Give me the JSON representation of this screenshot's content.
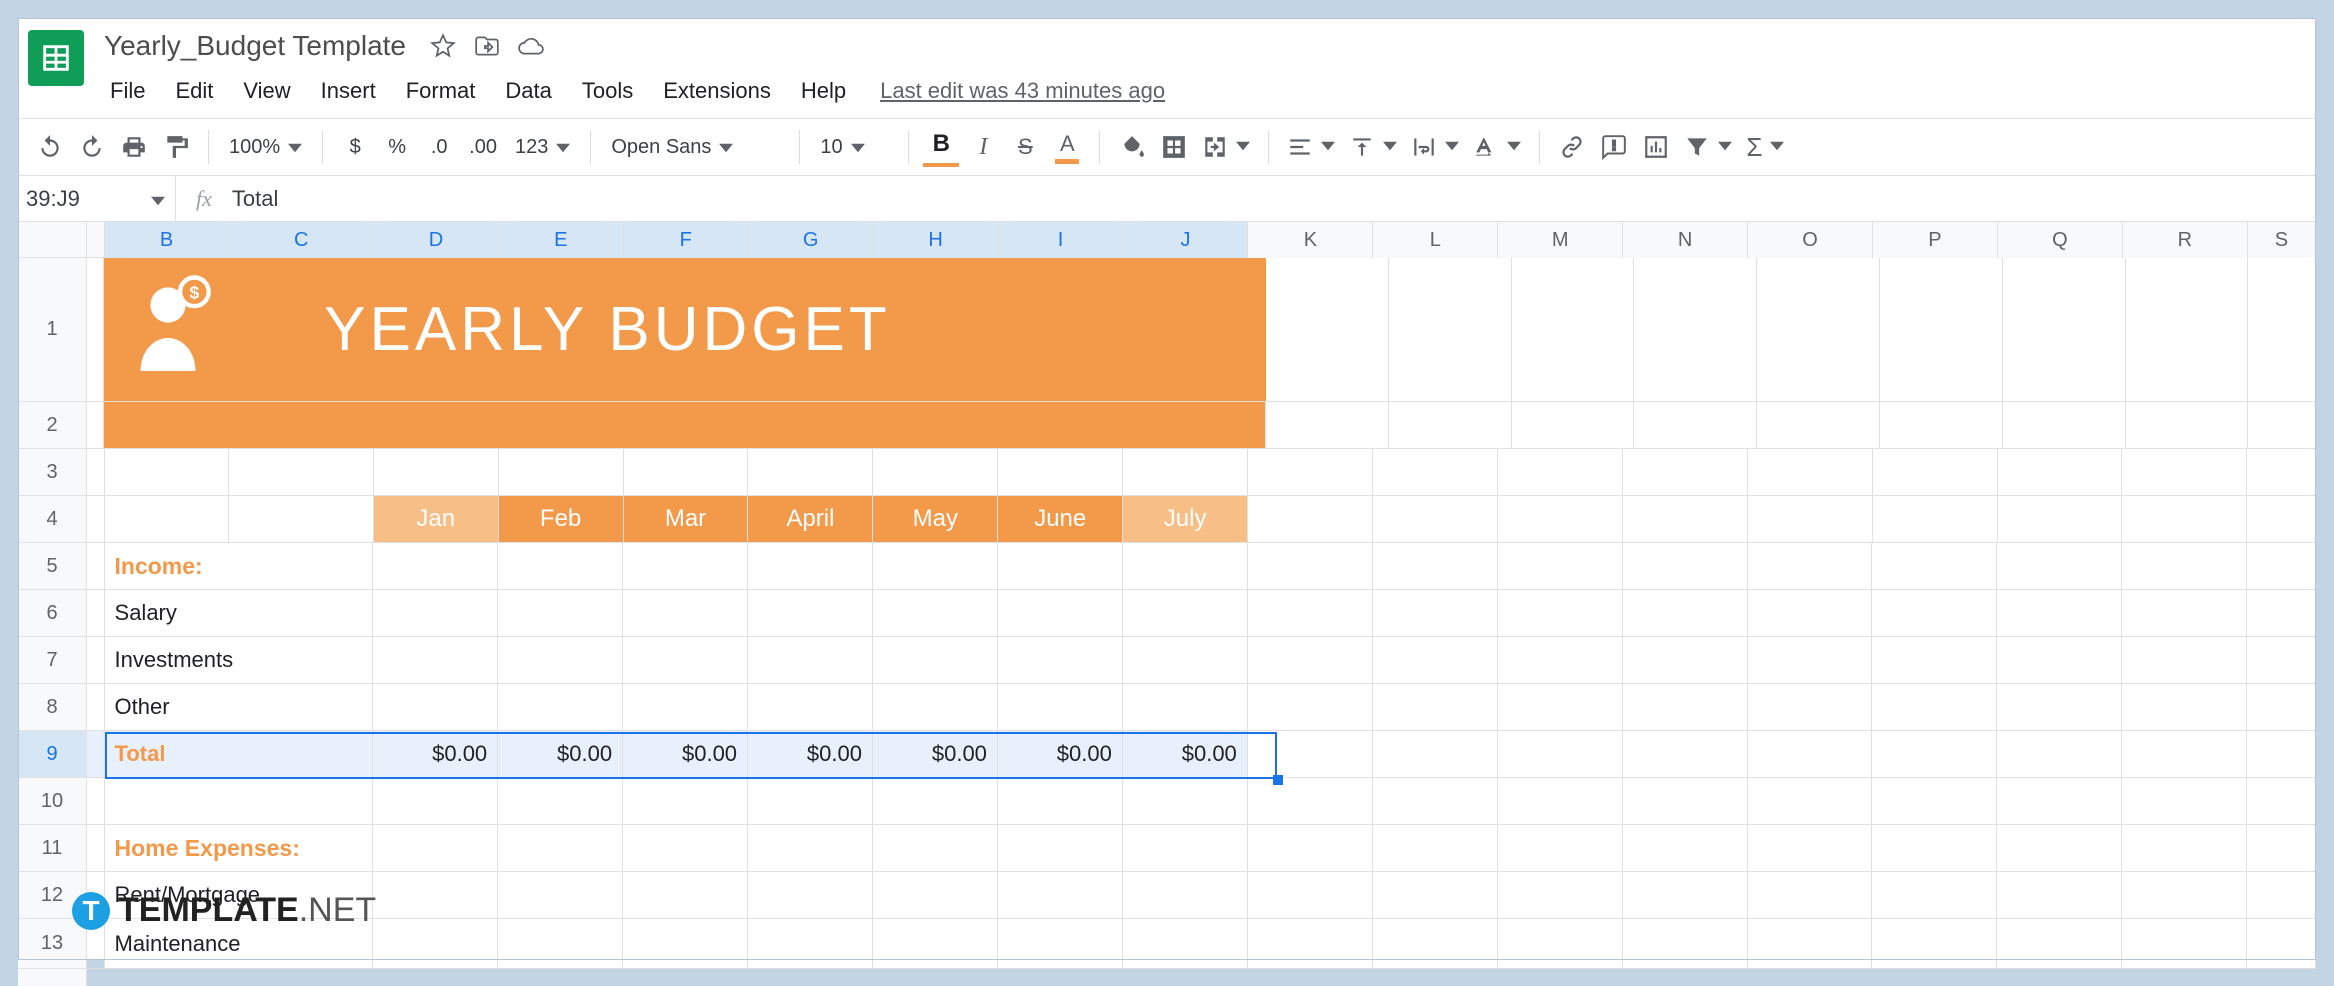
{
  "doc": {
    "title": "Yearly_Budget Template",
    "last_edit": "Last edit was 43 minutes ago"
  },
  "menus": [
    "File",
    "Edit",
    "View",
    "Insert",
    "Format",
    "Data",
    "Tools",
    "Extensions",
    "Help"
  ],
  "toolbar": {
    "zoom": "100%",
    "font": "Open Sans",
    "font_size": "10",
    "num_dec_dec": ".0",
    "num_inc_dec": ".00",
    "num_fmt": "123",
    "currency": "$",
    "percent": "%"
  },
  "namebox": "39:J9",
  "fx_value": "Total",
  "columns": [
    "B",
    "C",
    "D",
    "E",
    "F",
    "G",
    "H",
    "I",
    "J",
    "K",
    "L",
    "M",
    "N",
    "O",
    "P",
    "Q",
    "R",
    "S"
  ],
  "row_numbers": [
    "1",
    "2",
    "3",
    "4",
    "5",
    "6",
    "7",
    "8",
    "9",
    "10",
    "11",
    "12",
    "13"
  ],
  "banner_title": "YEARLY  BUDGET",
  "months": [
    "Jan",
    "Feb",
    "Mar",
    "April",
    "May",
    "June",
    "July"
  ],
  "sections": {
    "income_label": "Income:",
    "home_label": "Home Expenses:"
  },
  "income_rows": [
    "Salary",
    "Investments",
    "Other"
  ],
  "total_label": "Total",
  "total_values": [
    "$0.00",
    "$0.00",
    "$0.00",
    "$0.00",
    "$0.00",
    "$0.00",
    "$0.00"
  ],
  "home_rows": [
    "Rent/Mortgage",
    "Maintenance"
  ],
  "watermark": {
    "brand": "TEMPLATE",
    "suffix": ".NET",
    "badge": "T"
  }
}
